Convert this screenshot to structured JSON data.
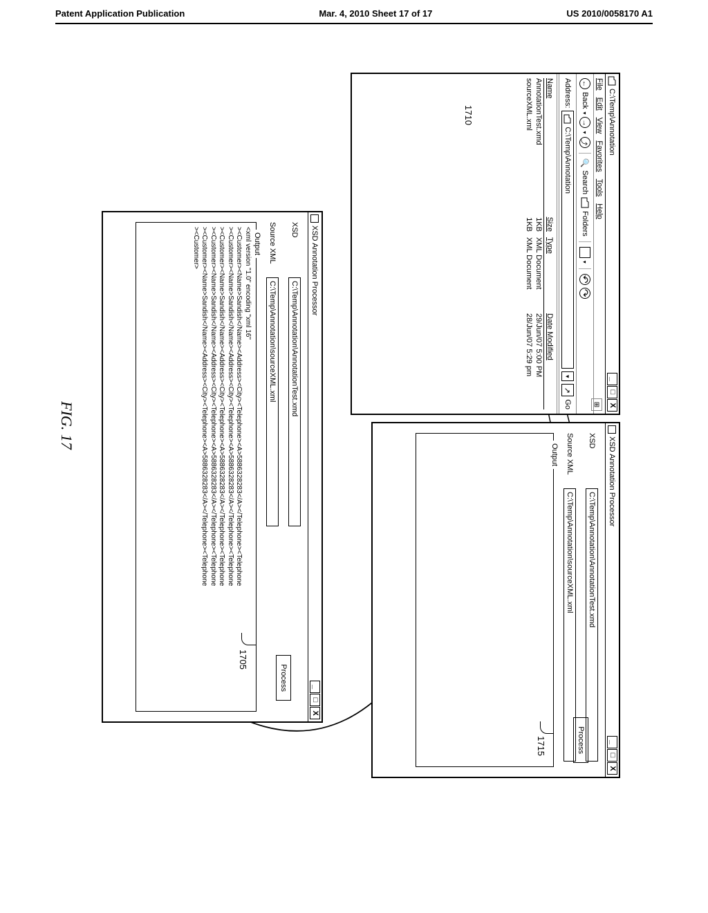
{
  "page_header": {
    "left": "Patent Application Publication",
    "center": "Mar. 4, 2010  Sheet 17 of 17",
    "right": "US 2010/0058170 A1"
  },
  "explorer": {
    "title": "C:\\Temp\\Annotation",
    "menu": {
      "file": "File",
      "edit": "Edit",
      "view": "View",
      "favorites": "Favorites",
      "tools": "Tools",
      "help": "Help"
    },
    "toolbar": {
      "back": "Back",
      "search": "Search",
      "folders": "Folders"
    },
    "address_label": "Address:",
    "address_value": "C:\\Temp\\Annotation",
    "go_label": "Go",
    "columns": {
      "name": "Name",
      "size": "Size",
      "type": "Type",
      "date": "Date Modified"
    },
    "rows": [
      {
        "name": "AnnotationTest.xmd",
        "size": "1KB",
        "type": "XML Document",
        "date": "29/Jun/07 5:00 PM"
      },
      {
        "name": "sourceXML.xml",
        "size": "1KB",
        "type": "XML Document",
        "date": "28/Jun/07 5:29 pm"
      }
    ]
  },
  "proc_top": {
    "title": "XSD Annotation Processor",
    "xsd_label": "XSD",
    "xsd_value": "C:\\Temp\\Annotation\\AnnotationTest.xmd",
    "src_label": "Source XML",
    "src_value": "C:\\Temp\\Annotation\\sourceXML.xml",
    "process": "Process",
    "output_label": "Output"
  },
  "proc_bot": {
    "title": "XSD Annotation Processor",
    "xsd_label": "XSD",
    "xsd_value": "C:\\Temp\\Annotation\\AnnotationTest.xmd",
    "src_label": "Source XML",
    "src_value": "C:\\Temp\\Annotation\\sourceXML.xml",
    "process": "Process",
    "output_label": "Output",
    "output_lines": [
      "<xml version \"1.0\" encoding \"xml 16\"",
      "><Customer><Name>Sandish</Name><Address><City><Telephone><A>5886328283</A></Telephone><Telephone",
      "><Customer><Name>Sandish</Name><Address><City><Telephone><A>5886328283</A></Telephone><Telephone",
      "><Customer><Name>Sandish</Name><Address><City><Telephone><A>5886328283</A></Telephone><Telephone",
      "><Customer><Name>Sandish</Name><Address><City><Telephone><A>5886328283</A></Telephone><Telephone",
      "><Customer><Name>Sandish</Name><Address><City><Telephone><A>5886328283</A></Telephone><Telephone",
      "><Customer>"
    ]
  },
  "refs": {
    "r1710": "1710",
    "r1715": "1715",
    "r1705": "1705"
  },
  "figure_label": "FIG. 17"
}
